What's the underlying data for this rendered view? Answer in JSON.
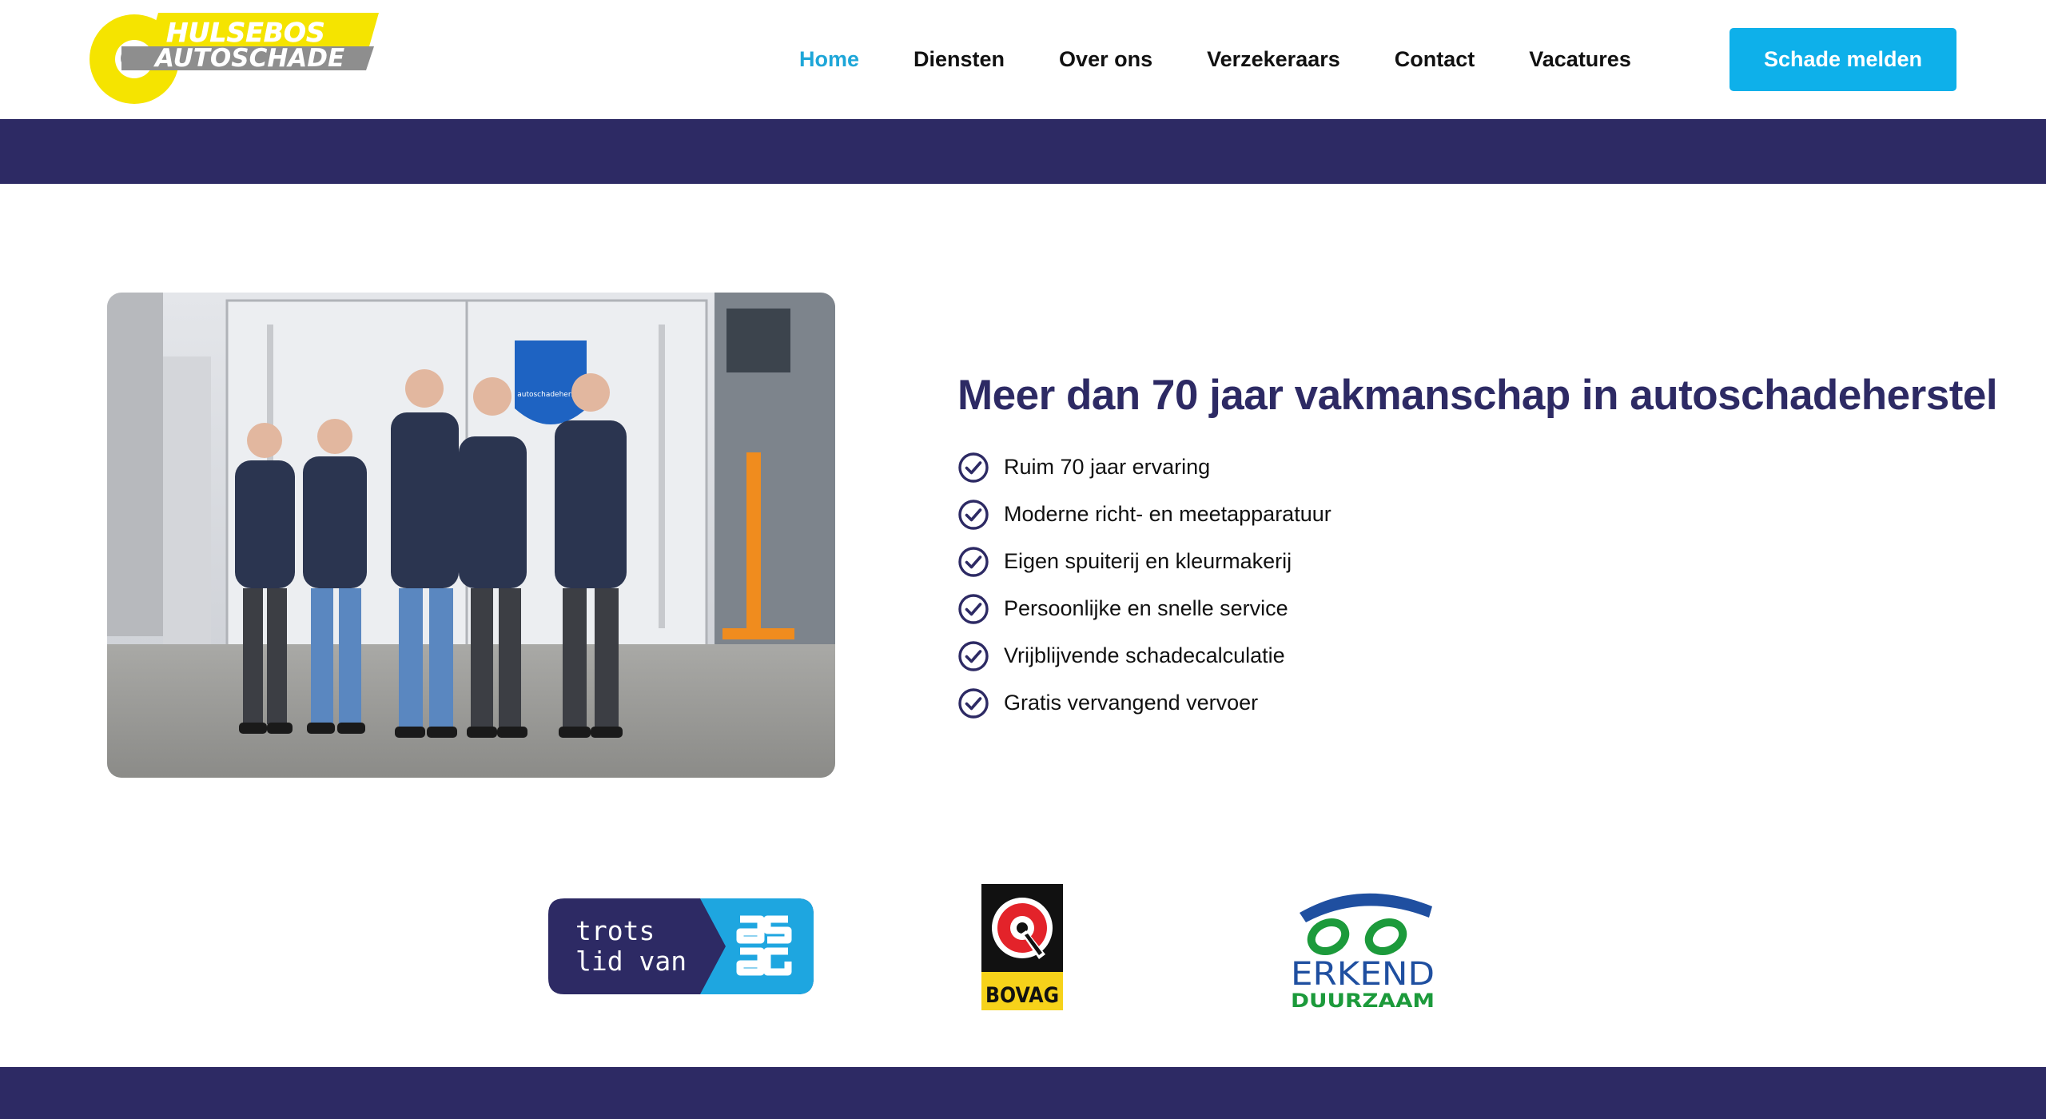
{
  "colors": {
    "navy": "#2d2a64",
    "accent_blue": "#0eb0ea",
    "active_nav": "#1ea6d8",
    "logo_yellow": "#f5e400",
    "logo_grey": "#8e8e8e"
  },
  "logo": {
    "line1": "HULSEBOS",
    "line2": "AUTOSCHADE"
  },
  "nav": {
    "items": [
      {
        "label": "Home",
        "active": true
      },
      {
        "label": "Diensten",
        "active": false
      },
      {
        "label": "Over ons",
        "active": false
      },
      {
        "label": "Verzekeraars",
        "active": false
      },
      {
        "label": "Contact",
        "active": false
      },
      {
        "label": "Vacatures",
        "active": false
      }
    ],
    "cta_label": "Schade melden"
  },
  "photo": {
    "badge_text": "autoschadeherstel"
  },
  "main": {
    "headline": "Meer dan 70 jaar vakmanschap in autoschadeherstel",
    "features": [
      "Ruim 70 jaar ervaring",
      "Moderne richt- en meetapparatuur",
      "Eigen spuiterij en kleurmakerij",
      "Persoonlijke en snelle service",
      "Vrijblijvende schadecalculatie",
      "Gratis vervangend vervoer"
    ]
  },
  "partners": {
    "asa_line1": "trots",
    "asa_line2": "lid van",
    "bovag": "BOVAG",
    "erkend_line1": "ERKEND",
    "erkend_line2": "DUURZAAM"
  }
}
